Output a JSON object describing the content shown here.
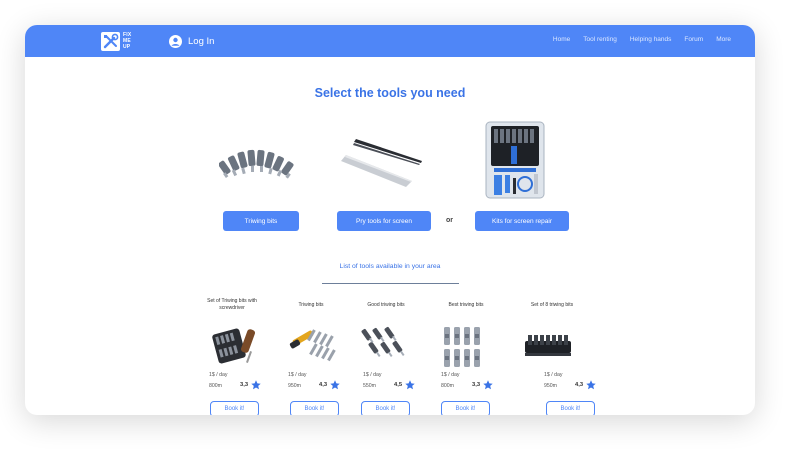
{
  "colors": {
    "accent": "#4f86f7",
    "heading": "#3a73e6"
  },
  "nav": {
    "logo_text": [
      "FIX",
      "ME",
      "UP"
    ],
    "login_label": "Log In",
    "links": [
      "Home",
      "Tool renting",
      "Helping hands",
      "Forum",
      "More"
    ]
  },
  "heading": "Select the tools you need",
  "categories": [
    {
      "label": "Triwing bits"
    },
    {
      "label": "Pry tools for screen"
    },
    {
      "label": "Kits for screen repair"
    }
  ],
  "or_label": "or",
  "list_title": "List of tools available in your area",
  "tools": [
    {
      "title": "Set of Triwing bits with screwdriver",
      "price": "1$ / day",
      "distance": "800m",
      "rating": "3,3",
      "button": "Book it!"
    },
    {
      "title": "Triwing bits",
      "price": "1$ / day",
      "distance": "950m",
      "rating": "4,3",
      "button": "Book it!"
    },
    {
      "title": "Good triwing bits",
      "price": "1$ / day",
      "distance": "550m",
      "rating": "4,5",
      "button": "Book it!"
    },
    {
      "title": "Best triwing bits",
      "price": "1$ / day",
      "distance": "800m",
      "rating": "3,3",
      "button": "Book it!"
    },
    {
      "title": "Set of 8 triwing bits",
      "price": "1$ / day",
      "distance": "950m",
      "rating": "4,3",
      "button": "Book it!"
    }
  ]
}
